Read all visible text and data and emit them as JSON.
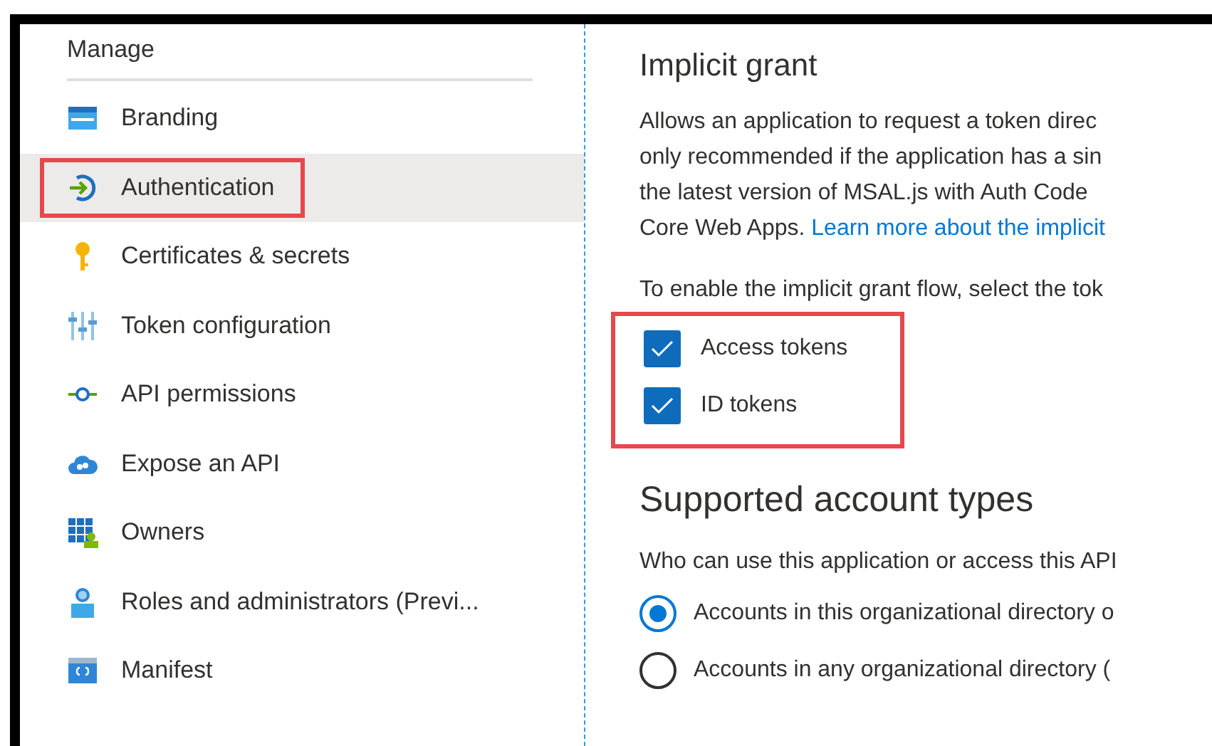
{
  "sidebar": {
    "heading": "Manage",
    "items": [
      {
        "label": "Branding",
        "selected": false,
        "highlighted": false
      },
      {
        "label": "Authentication",
        "selected": true,
        "highlighted": true
      },
      {
        "label": "Certificates & secrets",
        "selected": false,
        "highlighted": false
      },
      {
        "label": "Token configuration",
        "selected": false,
        "highlighted": false
      },
      {
        "label": "API permissions",
        "selected": false,
        "highlighted": false
      },
      {
        "label": "Expose an API",
        "selected": false,
        "highlighted": false
      },
      {
        "label": "Owners",
        "selected": false,
        "highlighted": false
      },
      {
        "label": "Roles and administrators (Previ...",
        "selected": false,
        "highlighted": false
      },
      {
        "label": "Manifest",
        "selected": false,
        "highlighted": false
      }
    ]
  },
  "implicit_grant": {
    "title": "Implicit grant",
    "paragraph_lines": [
      "Allows an application to request a token direc",
      "only recommended if the application has a sin",
      "the latest version of MSAL.js with Auth Code",
      "Core Web Apps. "
    ],
    "link": "Learn more about the implicit",
    "instruction": "To enable the implicit grant flow, select the tok",
    "checkboxes_highlighted": true,
    "checkboxes": [
      {
        "label": "Access tokens",
        "checked": true
      },
      {
        "label": "ID tokens",
        "checked": true
      }
    ]
  },
  "account_types": {
    "title": "Supported account types",
    "question": "Who can use this application or access this API",
    "options": [
      {
        "label": "Accounts in this organizational directory o",
        "selected": true
      },
      {
        "label": "Accounts in any organizational directory (",
        "selected": false
      }
    ]
  }
}
